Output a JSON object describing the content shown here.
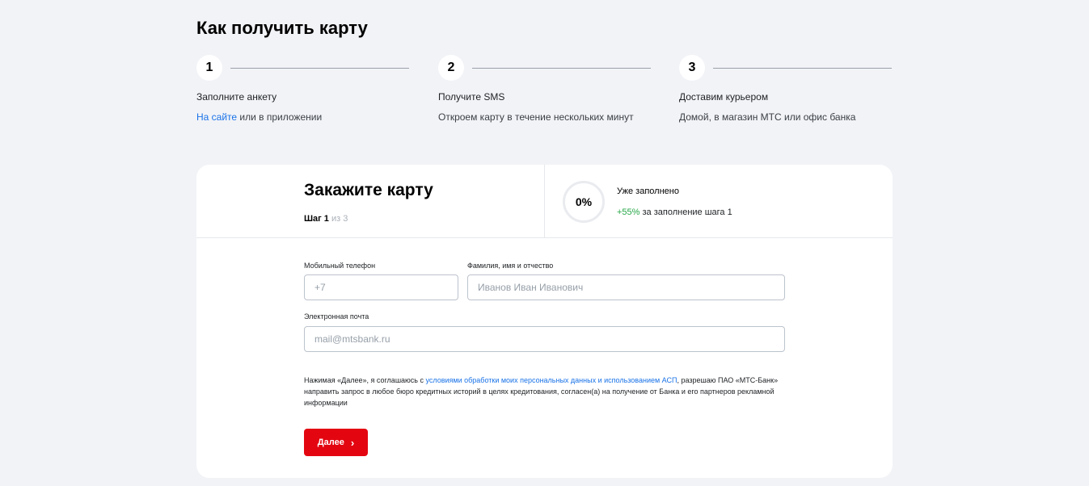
{
  "page_title": "Как получить карту",
  "steps": [
    {
      "number": "1",
      "title": "Заполните анкету",
      "link_text": "На сайте",
      "text": " или в приложении"
    },
    {
      "number": "2",
      "title": "Получите SMS",
      "text": "Откроем карту в течение нескольких минут"
    },
    {
      "number": "3",
      "title": "Доставим курьером",
      "text": "Домой, в магазин МТС или офис банка"
    }
  ],
  "form": {
    "title": "Закажите карту",
    "step_current": "Шаг 1",
    "step_total": " из 3",
    "progress_label": "0%",
    "progress_value": 0,
    "filled_title": "Уже заполнено",
    "filled_bonus": "+55%",
    "filled_bonus_text": " за заполнение шага 1",
    "phone": {
      "label": "Мобильный телефон",
      "placeholder": "+7"
    },
    "fullname": {
      "label": "Фамилия, имя и отчество",
      "placeholder": "Иванов Иван Иванович"
    },
    "email": {
      "label": "Электронная почта",
      "placeholder": "mail@mtsbank.ru"
    },
    "consent_prefix": "Нажимая «Далее», я соглашаюсь с ",
    "consent_link": "условиями обработки моих персональных данных и использованием АСП",
    "consent_suffix": ", разрешаю ПАО «МТС-Банк» направить запрос в любое бюро кредитных историй в целях кредитования, согласен(а) на получение от Банка и его партнеров рекламной информации",
    "next_button": "Далее"
  },
  "colors": {
    "accent_red": "#e30611",
    "link_blue": "#1a73e8",
    "success_green": "#26a748",
    "background": "#f2f3f7"
  }
}
